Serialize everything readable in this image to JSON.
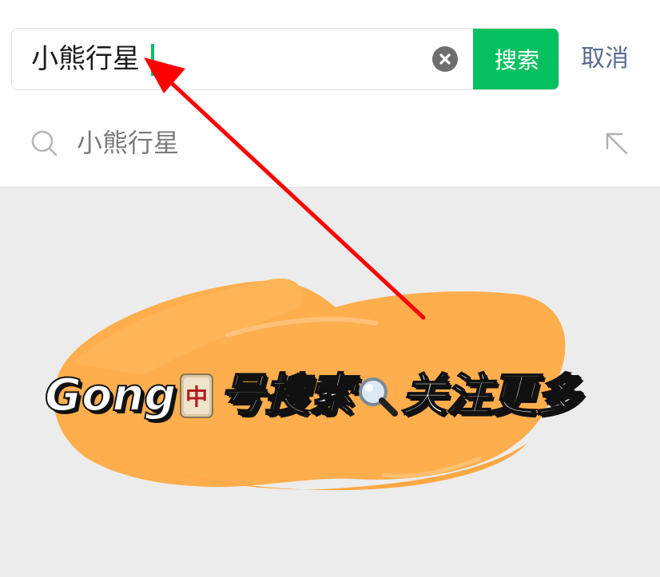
{
  "search": {
    "query": "小熊行星",
    "search_button_label": "搜索",
    "cancel_label": "取消"
  },
  "suggestions": [
    {
      "text": "小熊行星"
    }
  ],
  "banner": {
    "part1": "Gong",
    "mahjong_tile_glyph": "中",
    "part2": "号搜索",
    "part3": "关注更多"
  },
  "colors": {
    "accent_green": "#07c160",
    "link_blue": "#576b95",
    "arrow_red": "#ff0000",
    "brush_orange": "#ffae4d",
    "page_background": "#ececec"
  },
  "icons": [
    "clear-icon",
    "search-icon",
    "fill-query-arrow-icon",
    "mahjong-tile-icon",
    "magnifier-icon"
  ]
}
